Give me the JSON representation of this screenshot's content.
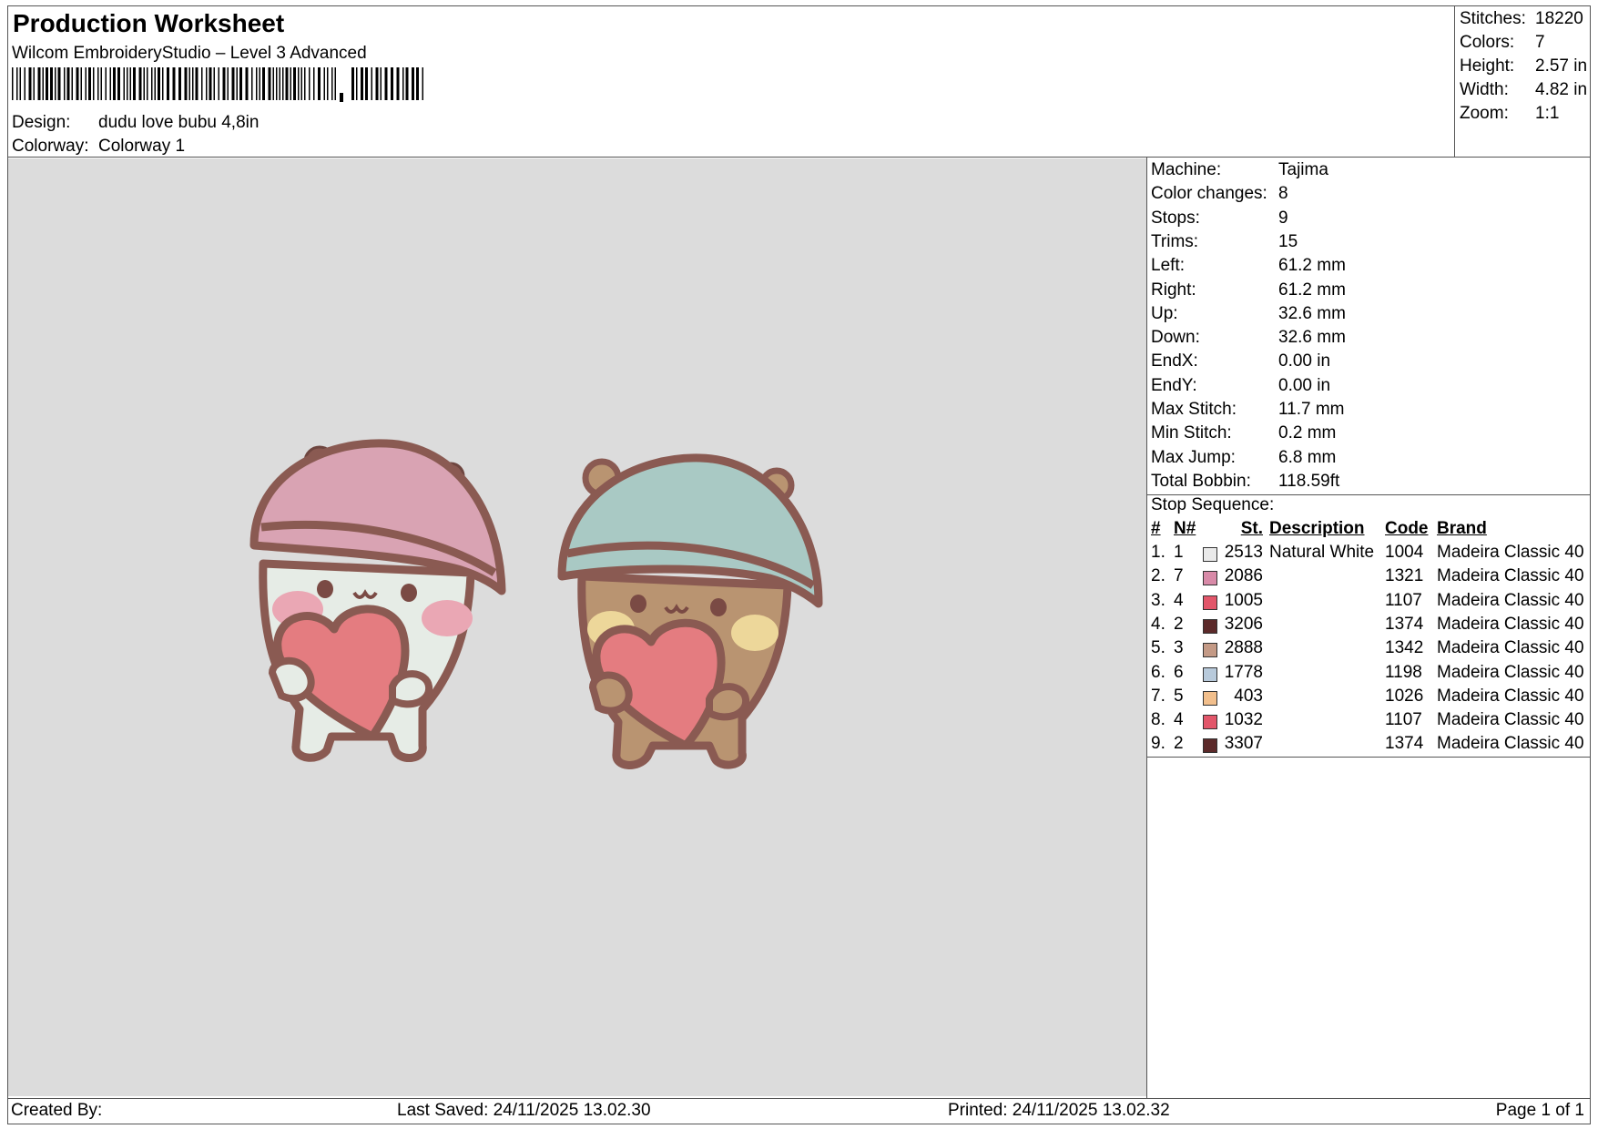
{
  "header": {
    "title": "Production Worksheet",
    "software": "Wilcom EmbroideryStudio – Level 3 Advanced",
    "design_label": "Design:",
    "design_value": "dudu love bubu 4,8in",
    "colorway_label": "Colorway:",
    "colorway_value": "Colorway 1"
  },
  "summary": [
    {
      "label": "Stitches:",
      "value": "18220"
    },
    {
      "label": "Colors:",
      "value": "7"
    },
    {
      "label": "Height:",
      "value": "2.57 in"
    },
    {
      "label": "Width:",
      "value": "4.82 in"
    },
    {
      "label": "Zoom:",
      "value": "1:1"
    }
  ],
  "machine_info": [
    {
      "label": "Machine:",
      "value": "Tajima"
    },
    {
      "label": "Color changes:",
      "value": "8"
    },
    {
      "label": "Stops:",
      "value": "9"
    },
    {
      "label": "Trims:",
      "value": "15"
    },
    {
      "label": "Left:",
      "value": "61.2 mm"
    },
    {
      "label": "Right:",
      "value": "61.2 mm"
    },
    {
      "label": "Up:",
      "value": "32.6 mm"
    },
    {
      "label": "Down:",
      "value": "32.6 mm"
    },
    {
      "label": "EndX:",
      "value": "0.00 in"
    },
    {
      "label": "EndY:",
      "value": "0.00 in"
    },
    {
      "label": "Max Stitch:",
      "value": "11.7 mm"
    },
    {
      "label": "Min Stitch:",
      "value": "0.2 mm"
    },
    {
      "label": "Max Jump:",
      "value": "6.8 mm"
    },
    {
      "label": "Total Bobbin:",
      "value": "118.59ft"
    }
  ],
  "stop_sequence": {
    "title": "Stop Sequence:",
    "headers": {
      "num": "#",
      "n": "N#",
      "st": "St.",
      "description": "Description",
      "code": "Code",
      "brand": "Brand"
    },
    "rows": [
      {
        "num": "1.",
        "n": "1",
        "st": "2513",
        "description": "Natural White",
        "code": "1004",
        "brand": "Madeira Classic 40",
        "color": "#eaeaea"
      },
      {
        "num": "2.",
        "n": "7",
        "st": "2086",
        "description": "",
        "code": "1321",
        "brand": "Madeira Classic 40",
        "color": "#d88aa8"
      },
      {
        "num": "3.",
        "n": "4",
        "st": "1005",
        "description": "",
        "code": "1107",
        "brand": "Madeira Classic 40",
        "color": "#e2566a"
      },
      {
        "num": "4.",
        "n": "2",
        "st": "3206",
        "description": "",
        "code": "1374",
        "brand": "Madeira Classic 40",
        "color": "#5c2a2a"
      },
      {
        "num": "5.",
        "n": "3",
        "st": "2888",
        "description": "",
        "code": "1342",
        "brand": "Madeira Classic 40",
        "color": "#c49a86"
      },
      {
        "num": "6.",
        "n": "6",
        "st": "1778",
        "description": "",
        "code": "1198",
        "brand": "Madeira Classic 40",
        "color": "#b8cadb"
      },
      {
        "num": "7.",
        "n": "5",
        "st": "403",
        "description": "",
        "code": "1026",
        "brand": "Madeira Classic 40",
        "color": "#f2bf8c"
      },
      {
        "num": "8.",
        "n": "4",
        "st": "1032",
        "description": "",
        "code": "1107",
        "brand": "Madeira Classic 40",
        "color": "#e2566a"
      },
      {
        "num": "9.",
        "n": "2",
        "st": "3307",
        "description": "",
        "code": "1374",
        "brand": "Madeira Classic 40",
        "color": "#5c2a2a"
      }
    ]
  },
  "footer": {
    "created_by": "Created By:",
    "last_saved": "Last Saved: 24/11/2025 13.02.30",
    "printed": "Printed: 24/11/2025 13.02.32",
    "page": "Page 1 of 1"
  },
  "colors": {
    "canvas_bg": "#dcdcdc",
    "outline": "#8a5a52",
    "pink_hat": "#d9a3b3",
    "blue_hat": "#a9c9c4",
    "white_body": "#e6ece6",
    "brown_body": "#b99471",
    "heart": "#e47c80",
    "cheek_pink": "#eaa7b4",
    "cheek_yellow": "#edd79a"
  }
}
